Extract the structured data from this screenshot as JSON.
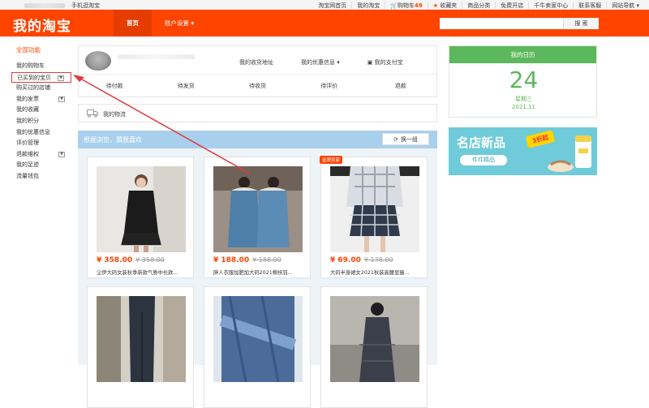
{
  "topbar": {
    "mobile_link": "手机逛淘宝",
    "links": [
      "淘宝网首页",
      "我的淘宝",
      "购物车",
      "收藏夹",
      "商品分类",
      "免费开店",
      "千牛卖家中心",
      "联系客服",
      "网站导航"
    ],
    "cart_count": "49"
  },
  "header": {
    "logo": "我的淘宝",
    "nav": [
      "首页",
      "账户设置"
    ],
    "search_button": "搜 索"
  },
  "sidebar": {
    "head": "全部功能",
    "items": [
      {
        "label": "我的购物车",
        "expand": false
      },
      {
        "label": "已买到的宝贝",
        "expand": true
      },
      {
        "label": "购买过的店铺",
        "expand": false
      },
      {
        "label": "我的发票",
        "expand": true
      },
      {
        "label": "我的收藏",
        "expand": false
      },
      {
        "label": "我的积分",
        "expand": false
      },
      {
        "label": "我的优惠信息",
        "expand": false
      },
      {
        "label": "评价管理",
        "expand": false
      },
      {
        "label": "退款维权",
        "expand": true
      },
      {
        "label": "我的足迹",
        "expand": false
      },
      {
        "label": "流量钱包",
        "expand": false
      }
    ]
  },
  "profile": {
    "links": [
      "我的收货地址",
      "我的优惠信息",
      "我的支付宝"
    ],
    "tabs": [
      "待付款",
      "待发货",
      "待收货",
      "待评价",
      "退款"
    ]
  },
  "logistics": {
    "label": "我的物流"
  },
  "recommend": {
    "title": "根据浏览，猜我喜欢",
    "swap_label": "换一组",
    "products": [
      {
        "price": "¥ 358.00",
        "old_price": "¥ 358.00",
        "desc": "尘伊大码女装秋季新款气质中长款..."
      },
      {
        "price": "¥ 188.00",
        "old_price": "¥ 188.00",
        "desc": "胖人衣服加肥加大码2021棉袄羽..."
      },
      {
        "price": "¥ 69.00",
        "old_price": "¥ 178.00",
        "desc": "大码半身裙女2021秋装高腰显瘦...",
        "badge": "金牌卖家"
      },
      {
        "price": "",
        "old_price": "",
        "desc": ""
      },
      {
        "price": "",
        "old_price": "",
        "desc": ""
      },
      {
        "price": "",
        "old_price": "",
        "desc": ""
      }
    ]
  },
  "calendar": {
    "title": "我的日历",
    "day": "24",
    "weekday": "星期三",
    "year_month": "2021.11"
  },
  "ad": {
    "title": "名店新品",
    "badge": "3折起",
    "subtitle": "件件精品"
  },
  "colors": {
    "brand": "#ff4400",
    "calendar_green": "#5cb85c",
    "recommend_blue": "#a8d0ec",
    "highlight_red": "#e4393c"
  }
}
